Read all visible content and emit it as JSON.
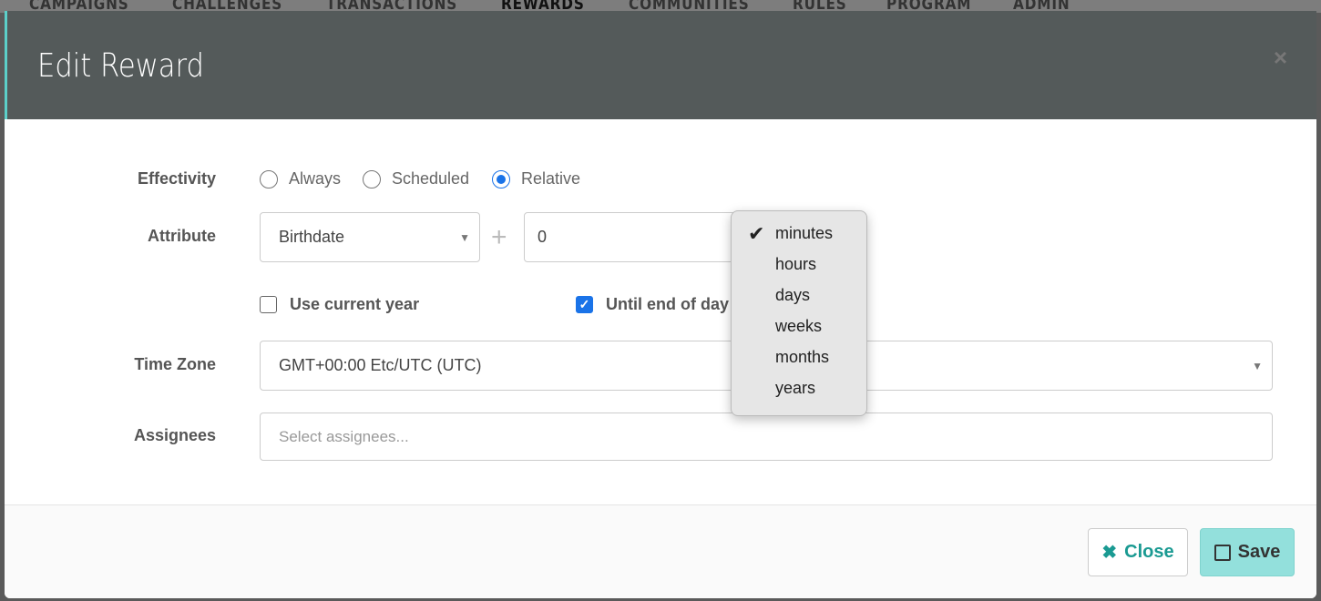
{
  "nav": [
    "CAMPAIGNS",
    "CHALLENGES",
    "TRANSACTIONS",
    "REWARDS",
    "COMMUNITIES",
    "RULES",
    "PROGRAM",
    "ADMIN"
  ],
  "modal": {
    "title": "Edit Reward",
    "close_icon": "×",
    "effectivity": {
      "label": "Effectivity",
      "options": [
        "Always",
        "Scheduled",
        "Relative"
      ],
      "selected": "Relative"
    },
    "attribute": {
      "label": "Attribute",
      "value": "Birthdate",
      "plus": "+",
      "offset": "0"
    },
    "use_current_year": {
      "label": "Use current year",
      "checked": false
    },
    "until_end_of_day": {
      "label": "Until end of day",
      "checked": true
    },
    "unit_dropdown": {
      "options": [
        "minutes",
        "hours",
        "days",
        "weeks",
        "months",
        "years"
      ],
      "selected": "minutes"
    },
    "time_zone": {
      "label": "Time Zone",
      "value": "GMT+00:00 Etc/UTC (UTC)"
    },
    "assignees": {
      "label": "Assignees",
      "placeholder": "Select assignees..."
    },
    "buttons": {
      "close": "Close",
      "save": "Save"
    },
    "colors": {
      "header": "#545a5a",
      "accent": "#5ccfc9",
      "save_bg": "#93e0dc",
      "close_text": "#1a9a92"
    }
  }
}
